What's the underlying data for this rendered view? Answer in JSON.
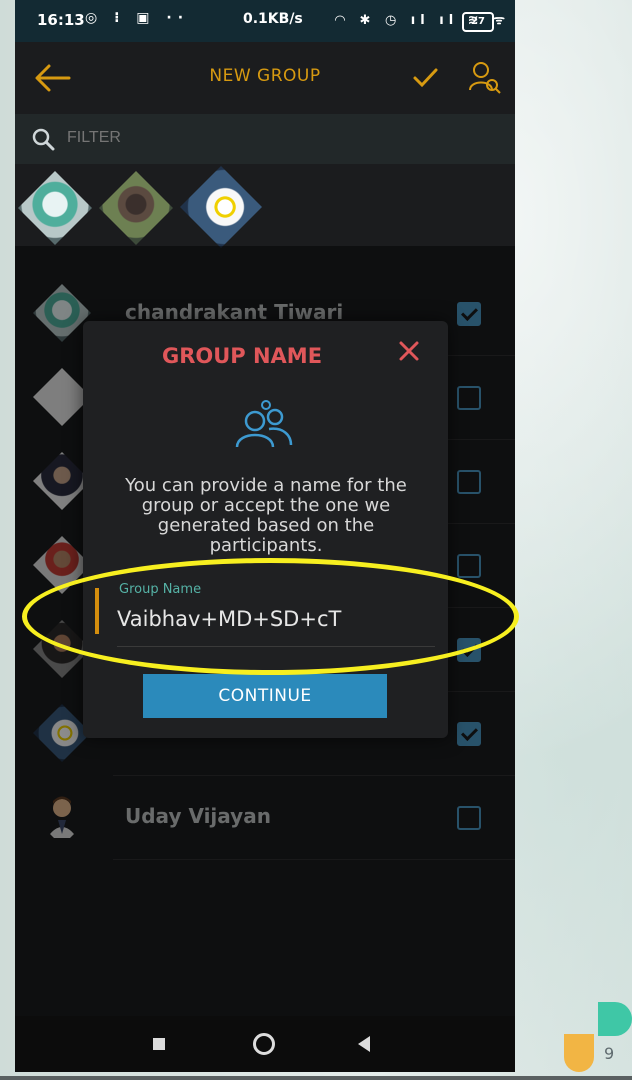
{
  "status_bar": {
    "time": "16:13",
    "speed": "0.1KB/s",
    "battery": "27"
  },
  "header": {
    "title": "NEW GROUP"
  },
  "filter": {
    "placeholder": "FILTER"
  },
  "contacts": [
    {
      "name": "chandrakant Tiwari",
      "checked": true
    },
    {
      "name": "",
      "checked": false
    },
    {
      "name": "",
      "checked": false
    },
    {
      "name": "",
      "checked": false
    },
    {
      "name": "",
      "checked": true
    },
    {
      "name": "",
      "checked": true
    },
    {
      "name": "Uday Vijayan",
      "checked": false
    }
  ],
  "dialog": {
    "title": "GROUP NAME",
    "text": "You can provide a name for the group or accept the one we generated based on the participants.",
    "field_label": "Group Name",
    "field_value": "Vaibhav+MD+SD+cT",
    "continue_label": "CONTINUE"
  },
  "slide_number": "9",
  "colors": {
    "accent": "#d79a11",
    "dialog_title": "#e0575a",
    "button": "#2b8abb",
    "checkbox": "#4a95c2",
    "highlight": "#f7ef20"
  }
}
